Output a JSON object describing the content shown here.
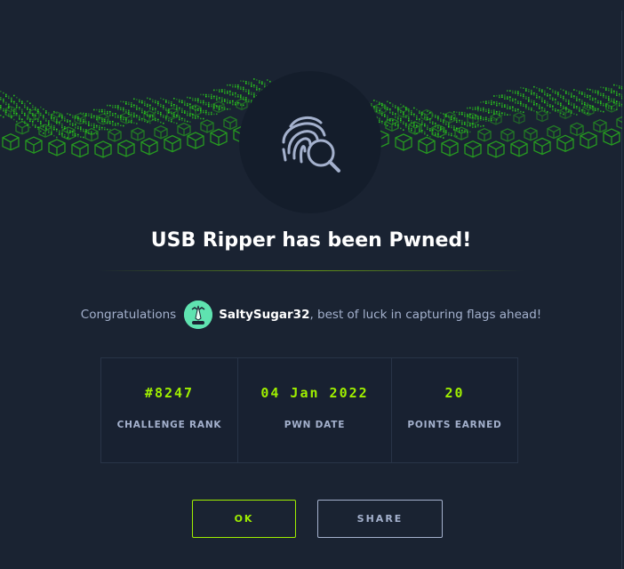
{
  "dialog": {
    "title": "USB Ripper has been Pwned!",
    "congrats_prefix": "Congratulations",
    "username": "SaltySugar32",
    "congrats_suffix": ", best of luck in capturing flags ahead!"
  },
  "stats": [
    {
      "value": "#8247",
      "label": "CHALLENGE RANK"
    },
    {
      "value": "04 Jan 2022",
      "label": "PWN DATE"
    },
    {
      "value": "20",
      "label": "POINTS EARNED"
    }
  ],
  "buttons": {
    "ok": "OK",
    "share": "SHARE"
  },
  "icons": {
    "badge": "fingerprint-search-icon",
    "avatar": "user-avatar"
  },
  "colors": {
    "background": "#1a2332",
    "accent_green": "#9fef00",
    "muted_text": "#a4b1cd",
    "badge_bg": "#141d2b",
    "avatar_bg": "#5fe3b0"
  }
}
